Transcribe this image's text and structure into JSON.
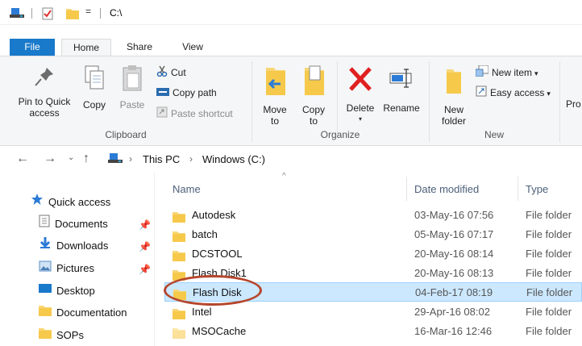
{
  "titlebar": {
    "path": "C:\\",
    "qat_dropdown": "="
  },
  "tabs": {
    "file": "File",
    "home": "Home",
    "share": "Share",
    "view": "View"
  },
  "ribbon": {
    "clipboard": {
      "label": "Clipboard",
      "pin_to_quick_access": "Pin to Quick access",
      "copy": "Copy",
      "paste": "Paste",
      "cut": "Cut",
      "copy_path": "Copy path",
      "paste_shortcut": "Paste shortcut"
    },
    "organize": {
      "label": "Organize",
      "move_to": "Move to",
      "copy_to": "Copy to",
      "delete": "Delete",
      "rename": "Rename"
    },
    "new": {
      "label": "New",
      "new_folder": "New folder",
      "new_item": "New item",
      "easy_access": "Easy access"
    },
    "properties_partial": "Pro"
  },
  "address": {
    "crumbs": [
      "This PC",
      "Windows (C:)"
    ]
  },
  "navpane": {
    "items": [
      {
        "label": "Quick access",
        "icon": "star-icon"
      },
      {
        "label": "Documents",
        "icon": "documents-icon",
        "pinned": true
      },
      {
        "label": "Downloads",
        "icon": "downloads-icon",
        "pinned": true
      },
      {
        "label": "Pictures",
        "icon": "pictures-icon",
        "pinned": true
      },
      {
        "label": "Desktop",
        "icon": "desktop-icon"
      },
      {
        "label": "Documentation",
        "icon": "folder-icon"
      },
      {
        "label": "SOPs",
        "icon": "folder-icon"
      }
    ]
  },
  "filelist": {
    "columns": [
      "Name",
      "Date modified",
      "Type"
    ],
    "rows": [
      {
        "name": "Autodesk",
        "date": "03-May-16 07:56",
        "type": "File folder"
      },
      {
        "name": "batch",
        "date": "05-May-16 07:17",
        "type": "File folder"
      },
      {
        "name": "DCSTOOL",
        "date": "20-May-16 08:14",
        "type": "File folder"
      },
      {
        "name": "Flash Disk1",
        "date": "20-May-16 08:13",
        "type": "File folder"
      },
      {
        "name": "Flash Disk",
        "date": "04-Feb-17 08:19",
        "type": "File folder",
        "selected": true
      },
      {
        "name": "Intel",
        "date": "29-Apr-16 08:02",
        "type": "File folder"
      },
      {
        "name": "MSOCache",
        "date": "16-Mar-16 12:46",
        "type": "File folder"
      }
    ]
  },
  "colors": {
    "file_tab": "#1979ca",
    "selection": "#cce8ff",
    "highlight_circle": "#b5462c",
    "folder": "#f8d675"
  }
}
